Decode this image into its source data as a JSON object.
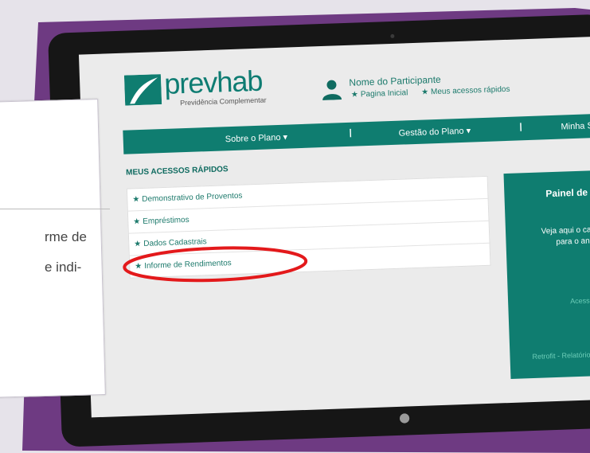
{
  "brand": {
    "logo_text": "prevhab",
    "logo_subtitle": "Previdência Complementar",
    "accent": "#0f7d70"
  },
  "user": {
    "name": "Nome do Participante",
    "links": [
      "Pagina Inicial",
      "Meus acessos rápidos"
    ]
  },
  "nav": {
    "items": [
      "Sobre o Plano",
      "Gestão do Plano",
      "Minha Situaçã"
    ]
  },
  "quick_access": {
    "title": "MEUS ACESSOS RÁPIDOS",
    "items": [
      "Demonstrativo de Proventos",
      "Empréstimos",
      "Dados Cadastrais",
      "Informe de Rendimentos"
    ],
    "highlighted": "Informe de Rendimentos",
    "highlight_color": "#e3191b"
  },
  "panel": {
    "title": "Painel de A",
    "text_lines": [
      "Veja aqui o calendári",
      "para o ano d"
    ],
    "links": [
      "Acesse o Ca",
      "Retrofit - Relatório s"
    ]
  },
  "card": {
    "text_lines": [
      "rme de",
      "e indi-"
    ]
  }
}
